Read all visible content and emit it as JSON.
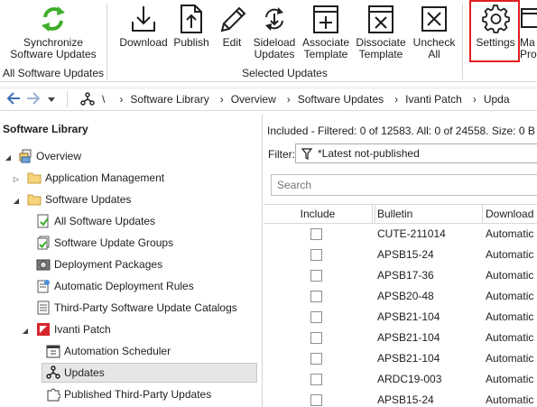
{
  "ribbon": {
    "buttons": [
      {
        "label1": "Synchronize",
        "label2": "Software Updates"
      },
      {
        "label1": "Download",
        "label2": ""
      },
      {
        "label1": "Publish",
        "label2": ""
      },
      {
        "label1": "Edit",
        "label2": ""
      },
      {
        "label1": "Sideload",
        "label2": "Updates"
      },
      {
        "label1": "Associate",
        "label2": "Template"
      },
      {
        "label1": "Dissociate",
        "label2": "Template"
      },
      {
        "label1": "Uncheck",
        "label2": "All"
      },
      {
        "label1": "Settings",
        "label2": ""
      },
      {
        "label1": "Ma",
        "label2": "Pro"
      }
    ],
    "groups": {
      "all_software_updates": "All Software Updates",
      "selected_updates": "Selected Updates"
    },
    "accent_color": "#e02020"
  },
  "addressbar": {
    "root": "\\",
    "crumbs": [
      "Software Library",
      "Overview",
      "Software Updates",
      "Ivanti Patch",
      "Upda"
    ]
  },
  "leftpanel": {
    "title": "Software Library",
    "tree": [
      {
        "label": "Overview"
      },
      {
        "label": "Application Management"
      },
      {
        "label": "Software Updates"
      },
      {
        "label": "All Software Updates"
      },
      {
        "label": "Software Update Groups"
      },
      {
        "label": "Deployment Packages"
      },
      {
        "label": "Automatic Deployment Rules"
      },
      {
        "label": "Third-Party Software Update Catalogs"
      },
      {
        "label": "Ivanti Patch"
      },
      {
        "label": "Automation Scheduler"
      },
      {
        "label": "Updates"
      },
      {
        "label": "Published Third-Party Updates"
      }
    ]
  },
  "rightpanel": {
    "status": "Included - Filtered: 0 of 12583.  All: 0 of 24558.  Size: 0 B",
    "filter_label": "Filter:",
    "filter_value": "*Latest not-published",
    "search_placeholder": "Search",
    "columns": [
      "Include",
      "Bulletin",
      "Download"
    ],
    "rows": [
      {
        "bulletin": "CUTE-211014",
        "download": "Automatic"
      },
      {
        "bulletin": "APSB15-24",
        "download": "Automatic"
      },
      {
        "bulletin": "APSB17-36",
        "download": "Automatic"
      },
      {
        "bulletin": "APSB20-48",
        "download": "Automatic"
      },
      {
        "bulletin": "APSB21-104",
        "download": "Automatic"
      },
      {
        "bulletin": "APSB21-104",
        "download": "Automatic"
      },
      {
        "bulletin": "APSB21-104",
        "download": "Automatic"
      },
      {
        "bulletin": "ARDC19-003",
        "download": "Automatic"
      },
      {
        "bulletin": "APSB15-24",
        "download": "Automatic"
      }
    ]
  }
}
